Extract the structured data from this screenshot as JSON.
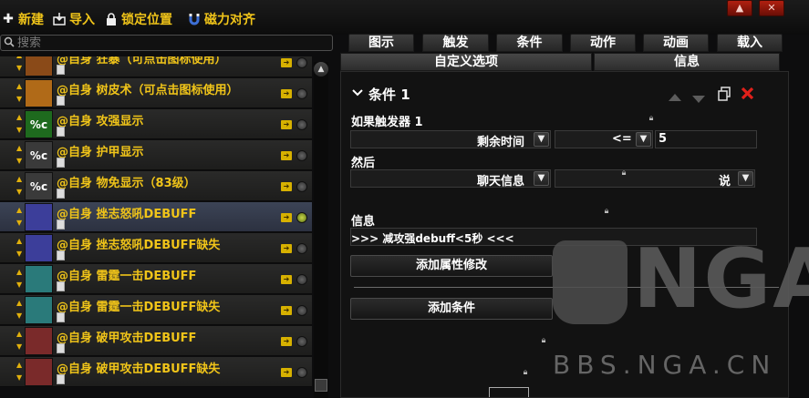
{
  "toolbar": {
    "new_label": "新建",
    "import_label": "导入",
    "lock_label": "锁定位置",
    "magnet_label": "磁力对齐"
  },
  "search": {
    "placeholder": "搜索"
  },
  "auras": [
    {
      "title": "@自身 狂暴（可点击图标使用）",
      "thumb": "",
      "thumb_color": "#8a4a18",
      "selected": false,
      "enabled": false
    },
    {
      "title": "@自身 树皮术（可点击图标使用）",
      "thumb": "",
      "thumb_color": "#b06a18",
      "selected": false,
      "enabled": false
    },
    {
      "title": "@自身 攻强显示",
      "thumb": "%c",
      "thumb_color": "#1e6a1e",
      "selected": false,
      "enabled": false
    },
    {
      "title": "@自身 护甲显示",
      "thumb": "%c",
      "thumb_color": "#3a3a3a",
      "selected": false,
      "enabled": false
    },
    {
      "title": "@自身 物免显示（83级）",
      "thumb": "%c",
      "thumb_color": "#3a3a3a",
      "selected": false,
      "enabled": false
    },
    {
      "title": "@自身 挫志怒吼DEBUFF",
      "thumb": "",
      "thumb_color": "#3c3e9a",
      "selected": true,
      "enabled": true
    },
    {
      "title": "@自身 挫志怒吼DEBUFF缺失",
      "thumb": "",
      "thumb_color": "#3c3e9a",
      "selected": false,
      "enabled": false
    },
    {
      "title": "@自身 雷霆一击DEBUFF",
      "thumb": "",
      "thumb_color": "#2a7a7a",
      "selected": false,
      "enabled": false
    },
    {
      "title": "@自身 雷霆一击DEBUFF缺失",
      "thumb": "",
      "thumb_color": "#2a7a7a",
      "selected": false,
      "enabled": false
    },
    {
      "title": "@自身 破甲攻击DEBUFF",
      "thumb": "",
      "thumb_color": "#7a2a2a",
      "selected": false,
      "enabled": false
    },
    {
      "title": "@自身 破甲攻击DEBUFF缺失",
      "thumb": "",
      "thumb_color": "#7a2a2a",
      "selected": false,
      "enabled": false
    }
  ],
  "tabs": [
    "图示",
    "触发",
    "条件",
    "动作",
    "动画",
    "载入"
  ],
  "subtabs": [
    "自定义选项",
    "信息"
  ],
  "condition": {
    "header": "条件 1",
    "if_label": "如果触发器 1",
    "property": "剩余时间",
    "operator": "<=",
    "value": "5",
    "then_label": "然后",
    "action": "聊天信息",
    "channel": "说",
    "message_label": "信息",
    "message": ">>>  减攻强debuff<5秒   <<<",
    "add_property_label": "添加属性修改",
    "add_condition_label": "添加条件"
  },
  "watermark": {
    "logo_text": "NGA",
    "url": "BBS.NGA.CN"
  },
  "icons": [
    "plus-icon",
    "import-icon",
    "lock-icon",
    "magnet-icon",
    "search-icon",
    "chevron-down-icon",
    "arrow-up-icon",
    "arrow-down-icon",
    "copy-icon",
    "delete-icon"
  ],
  "colors": {
    "accent_gold": "#f0c419",
    "delete_red": "#e0201a",
    "selected_row": "#3c4456"
  }
}
